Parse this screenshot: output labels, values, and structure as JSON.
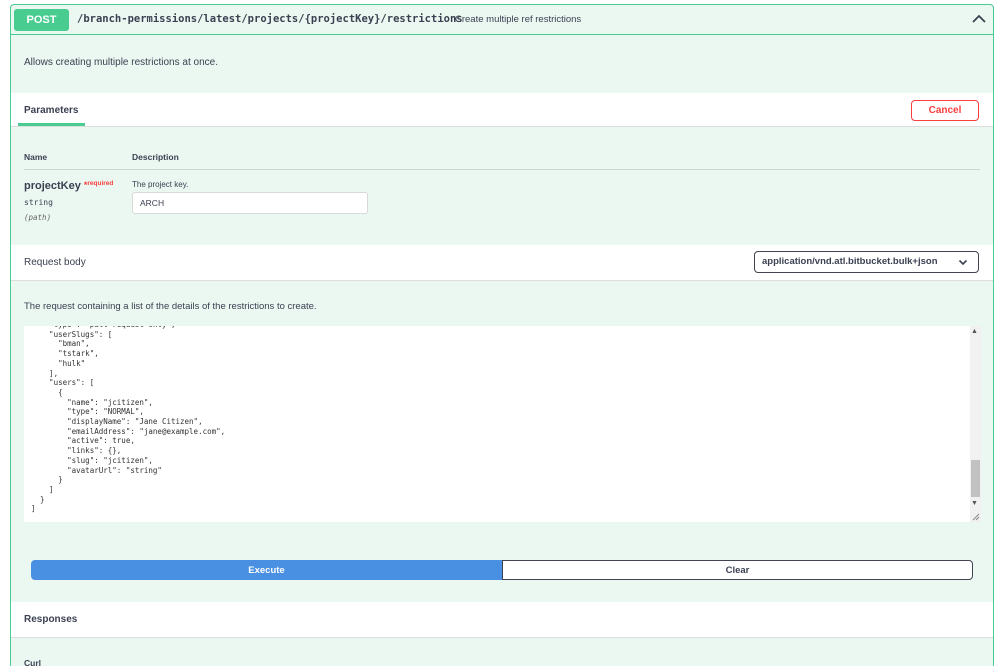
{
  "operation": {
    "method": "POST",
    "path": "/branch-permissions/latest/projects/{projectKey}/restrictions",
    "summary": "Create multiple ref restrictions",
    "description": "Allows creating multiple restrictions at once.",
    "collapse_icon": "chevron-up-icon"
  },
  "parameters": {
    "tab_label": "Parameters",
    "cancel_label": "Cancel",
    "col_name": "Name",
    "col_description": "Description",
    "items": [
      {
        "name": "projectKey",
        "required_star": "*",
        "required_label": "required",
        "type": "string",
        "in": "(path)",
        "description": "The project key.",
        "value": "ARCH"
      }
    ]
  },
  "request_body": {
    "title": "Request body",
    "content_type": "application/vnd.atl.bitbucket.bulk+json",
    "description": "The request containing a list of the details of the restrictions to create.",
    "code": "    \"type\": \"pull-request-only\",\n    \"userSlugs\": [\n      \"bman\",\n      \"tstark\",\n      \"hulk\"\n    ],\n    \"users\": [\n      {\n        \"name\": \"jcitizen\",\n        \"type\": \"NORMAL\",\n        \"displayName\": \"Jane Citizen\",\n        \"emailAddress\": \"jane@example.com\",\n        \"active\": true,\n        \"links\": {},\n        \"slug\": \"jcitizen\",\n        \"avatarUrl\": \"string\"\n      }\n    ]\n  }\n]"
  },
  "actions": {
    "execute_label": "Execute",
    "clear_label": "Clear"
  },
  "responses": {
    "title": "Responses",
    "curl_label": "Curl"
  },
  "colors": {
    "post_accent": "#49cc90",
    "execute": "#4990e2",
    "danger": "#f93e3e"
  }
}
